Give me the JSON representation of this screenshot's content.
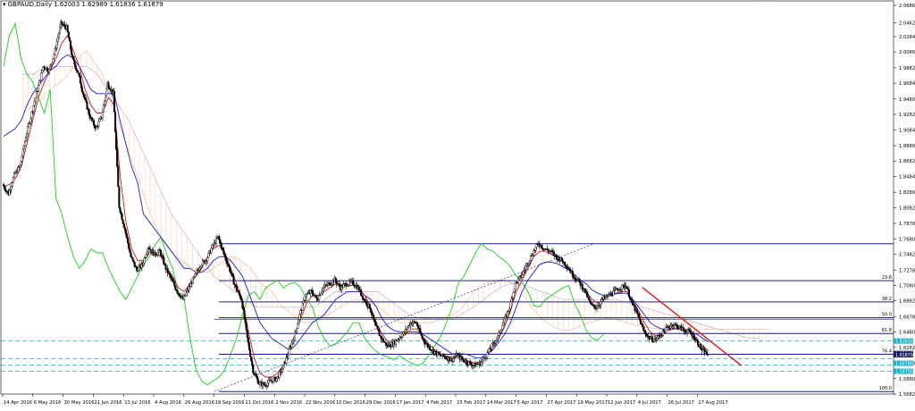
{
  "header": {
    "symbol_line": "GBPAUD,Daily",
    "ohlc": "1.62003 1.62989 1.61836 1.61879"
  },
  "colors": {
    "background": "#ffffff",
    "candle": "#000000",
    "tenkan": "#d01818",
    "kijun": "#1a1ad8",
    "chikou": "#18d018",
    "cloud": "#f2b48a",
    "fib": "#1c1c8a",
    "channel": "#2a2ab8",
    "support": "#1ab0c8",
    "trendline": "#e01818",
    "price_tag": "#1a1a60"
  },
  "chart_data": {
    "type": "line",
    "instrument": "GBPAUD",
    "timeframe": "Daily",
    "ohlc_current": {
      "open": 1.62003,
      "high": 1.62989,
      "low": 1.61836,
      "close": 1.61879
    },
    "y_ticks": [
      2.0686,
      2.0462,
      2.0284,
      2.0086,
      1.9882,
      1.9684,
      1.948,
      1.9282,
      1.9084,
      1.888,
      1.8682,
      1.8484,
      1.828,
      1.8082,
      1.7878,
      1.768,
      1.7482,
      1.7278,
      1.708,
      1.6882,
      1.6678,
      1.648,
      1.6282,
      1.6078,
      1.588,
      1.5682
    ],
    "ylim": [
      1.5682,
      2.0686
    ],
    "x_ticks": [
      "14 Apr 2016",
      "6 May 2016",
      "30 May 2016",
      "21 Jun 2016",
      "13 Jul 2016",
      "4 Aug 2016",
      "26 Aug 2016",
      "19 Sep 2016",
      "11 Oct 2016",
      "2 Nov 2016",
      "22 Nov 2016",
      "10 Dec 2016",
      "29 Dec 2016",
      "17 Jan 2017",
      "4 Feb 2017",
      "23 Feb 2017",
      "14 Mar 2017",
      "5 Apr 2017",
      "27 Apr 2017",
      "19 May 2017",
      "12 Jun 2017",
      "4 Jul 2017",
      "26 Jul 2017",
      "17 Aug 2017"
    ],
    "close_series": [
      1.838,
      1.826,
      1.85,
      1.862,
      1.9,
      1.93,
      1.96,
      1.99,
      1.985,
      2.01,
      2.045,
      2.04,
      2.0,
      1.98,
      1.95,
      1.925,
      1.91,
      1.925,
      1.968,
      1.955,
      1.81,
      1.78,
      1.745,
      1.728,
      1.735,
      1.758,
      1.748,
      1.752,
      1.73,
      1.715,
      1.7,
      1.69,
      1.705,
      1.72,
      1.735,
      1.742,
      1.758,
      1.77,
      1.748,
      1.728,
      1.705,
      1.69,
      1.64,
      1.598,
      1.582,
      1.58,
      1.585,
      1.588,
      1.6,
      1.62,
      1.64,
      1.67,
      1.695,
      1.7,
      1.69,
      1.705,
      1.71,
      1.715,
      1.705,
      1.71,
      1.712,
      1.705,
      1.69,
      1.68,
      1.655,
      1.64,
      1.63,
      1.633,
      1.64,
      1.648,
      1.66,
      1.66,
      1.64,
      1.63,
      1.623,
      1.618,
      1.616,
      1.612,
      1.618,
      1.612,
      1.608,
      1.605,
      1.608,
      1.618,
      1.63,
      1.642,
      1.66,
      1.68,
      1.71,
      1.72,
      1.735,
      1.75,
      1.762,
      1.755,
      1.752,
      1.745,
      1.74,
      1.732,
      1.72,
      1.712,
      1.7,
      1.682,
      1.68,
      1.69,
      1.695,
      1.7,
      1.705,
      1.708,
      1.685,
      1.67,
      1.65,
      1.64,
      1.638,
      1.645,
      1.653,
      1.658,
      1.655,
      1.65,
      1.648,
      1.638,
      1.625,
      1.619
    ],
    "series": [
      {
        "name": "Tenkan",
        "values": [
          1.835,
          1.838,
          1.845,
          1.86,
          1.89,
          1.92,
          1.95,
          1.97,
          1.985,
          2.0,
          2.02,
          2.03,
          2.01,
          1.99,
          1.96,
          1.94,
          1.93,
          1.93,
          1.95,
          1.94,
          1.85,
          1.79,
          1.755,
          1.74,
          1.74,
          1.75,
          1.75,
          1.745,
          1.73,
          1.72,
          1.705,
          1.7,
          1.71,
          1.72,
          1.73,
          1.745,
          1.755,
          1.76,
          1.75,
          1.73,
          1.71,
          1.69,
          1.65,
          1.615,
          1.595,
          1.59,
          1.59,
          1.595,
          1.605,
          1.625,
          1.645,
          1.665,
          1.685,
          1.695,
          1.695,
          1.7,
          1.705,
          1.71,
          1.708,
          1.708,
          1.708,
          1.704,
          1.695,
          1.68,
          1.66,
          1.645,
          1.635,
          1.635,
          1.64,
          1.645,
          1.652,
          1.652,
          1.642,
          1.632,
          1.625,
          1.62,
          1.617,
          1.615,
          1.617,
          1.614,
          1.61,
          1.608,
          1.61,
          1.618,
          1.628,
          1.64,
          1.655,
          1.675,
          1.7,
          1.715,
          1.73,
          1.745,
          1.752,
          1.752,
          1.748,
          1.744,
          1.738,
          1.73,
          1.72,
          1.71,
          1.7,
          1.69,
          1.685,
          1.69,
          1.695,
          1.698,
          1.7,
          1.7,
          1.688,
          1.675,
          1.66,
          1.648,
          1.643,
          1.645,
          1.65,
          1.653,
          1.652,
          1.649,
          1.645,
          1.638,
          1.63,
          1.624
        ]
      },
      {
        "name": "Kijun",
        "values": [
          1.9,
          1.905,
          1.91,
          1.92,
          1.94,
          1.955,
          1.965,
          1.975,
          1.985,
          1.99,
          2.0,
          2.005,
          2.0,
          1.99,
          1.975,
          1.96,
          1.955,
          1.955,
          1.955,
          1.955,
          1.92,
          1.89,
          1.86,
          1.84,
          1.8,
          1.79,
          1.78,
          1.77,
          1.76,
          1.75,
          1.74,
          1.73,
          1.73,
          1.725,
          1.725,
          1.73,
          1.74,
          1.745,
          1.745,
          1.74,
          1.73,
          1.72,
          1.7,
          1.68,
          1.66,
          1.65,
          1.64,
          1.635,
          1.63,
          1.625,
          1.63,
          1.64,
          1.65,
          1.66,
          1.665,
          1.67,
          1.68,
          1.69,
          1.695,
          1.7,
          1.7,
          1.7,
          1.695,
          1.69,
          1.68,
          1.665,
          1.655,
          1.65,
          1.648,
          1.648,
          1.648,
          1.648,
          1.645,
          1.64,
          1.635,
          1.63,
          1.625,
          1.62,
          1.62,
          1.62,
          1.618,
          1.615,
          1.615,
          1.62,
          1.625,
          1.635,
          1.645,
          1.66,
          1.68,
          1.7,
          1.715,
          1.725,
          1.735,
          1.738,
          1.738,
          1.736,
          1.732,
          1.728,
          1.722,
          1.715,
          1.71,
          1.702,
          1.698,
          1.695,
          1.695,
          1.697,
          1.698,
          1.698,
          1.69,
          1.68,
          1.67,
          1.66,
          1.655,
          1.652,
          1.652,
          1.652,
          1.652,
          1.65,
          1.648,
          1.645,
          1.64,
          1.635
        ]
      },
      {
        "name": "Chikou",
        "values": [
          1.99,
          2.03,
          2.045,
          2.0,
          1.98,
          1.97,
          1.95,
          1.93,
          1.96,
          1.82,
          1.8,
          1.77,
          1.745,
          1.73,
          1.74,
          1.755,
          1.75,
          1.75,
          1.73,
          1.715,
          1.7,
          1.69,
          1.705,
          1.72,
          1.735,
          1.745,
          1.76,
          1.77,
          1.748,
          1.73,
          1.7,
          1.69,
          1.64,
          1.6,
          1.585,
          1.58,
          1.585,
          1.59,
          1.6,
          1.62,
          1.64,
          1.67,
          1.695,
          1.7,
          1.69,
          1.705,
          1.71,
          1.715,
          1.705,
          1.71,
          1.712,
          1.705,
          1.69,
          1.68,
          1.655,
          1.64,
          1.63,
          1.633,
          1.64,
          1.648,
          1.66,
          1.66,
          1.64,
          1.63,
          1.623,
          1.618,
          1.616,
          1.612,
          1.618,
          1.612,
          1.608,
          1.605,
          1.608,
          1.618,
          1.63,
          1.642,
          1.66,
          1.68,
          1.71,
          1.72,
          1.735,
          1.75,
          1.762,
          1.755,
          1.752,
          1.745,
          1.74,
          1.732,
          1.72,
          1.712,
          1.7,
          1.682,
          1.68,
          1.69,
          1.695,
          1.7,
          1.705,
          1.708,
          1.685,
          1.67,
          1.65,
          1.64,
          1.638,
          1.645
        ]
      },
      {
        "name": "Senkou A",
        "values": [
          1.93,
          1.935,
          1.94,
          1.945,
          1.95,
          1.96,
          1.965,
          1.97,
          1.975,
          1.985,
          1.995,
          2.005,
          2.01,
          2.0,
          1.99,
          1.98,
          1.96,
          1.94,
          1.92,
          1.9,
          1.88,
          1.86,
          1.84,
          1.82,
          1.8,
          1.785,
          1.77,
          1.76,
          1.75,
          1.745,
          1.738,
          1.735,
          1.73,
          1.728,
          1.725,
          1.725,
          1.73,
          1.735,
          1.74,
          1.745,
          1.745,
          1.74,
          1.735,
          1.73,
          1.72,
          1.71,
          1.705,
          1.7,
          1.69,
          1.68,
          1.675,
          1.67,
          1.665,
          1.66,
          1.66,
          1.662,
          1.665,
          1.668,
          1.672,
          1.676,
          1.68,
          1.685,
          1.688,
          1.69,
          1.69,
          1.688,
          1.685,
          1.68,
          1.675,
          1.67,
          1.665,
          1.66,
          1.66,
          1.66,
          1.66,
          1.66,
          1.66,
          1.66,
          1.662,
          1.665,
          1.668,
          1.67,
          1.675,
          1.68,
          1.69,
          1.7,
          1.705,
          1.71,
          1.712,
          1.714,
          1.715,
          1.715,
          1.712,
          1.708,
          1.7,
          1.69,
          1.68,
          1.672,
          1.665,
          1.66,
          1.655,
          1.652,
          1.65,
          1.65,
          1.652,
          1.655,
          1.658,
          1.66,
          1.662,
          1.664,
          1.665,
          1.665,
          1.664,
          1.662,
          1.66,
          1.658,
          1.656,
          1.655,
          1.654,
          1.653,
          1.652,
          1.652,
          1.652,
          1.652,
          1.652,
          1.652,
          1.652,
          1.652,
          1.652,
          1.652,
          1.652,
          1.652,
          1.652,
          1.652,
          1.652,
          1.652,
          1.652,
          1.652,
          1.652,
          1.652,
          1.652,
          1.652
        ]
      },
      {
        "name": "Senkou B",
        "values": [
          1.98,
          1.98,
          1.98,
          1.985,
          1.985,
          1.99,
          1.99,
          1.99,
          1.99,
          1.99,
          1.99,
          1.99,
          1.99,
          1.985,
          1.98,
          1.97,
          1.96,
          1.95,
          1.94,
          1.93,
          1.92,
          1.905,
          1.89,
          1.875,
          1.86,
          1.845,
          1.83,
          1.815,
          1.8,
          1.79,
          1.78,
          1.77,
          1.76,
          1.75,
          1.74,
          1.73,
          1.72,
          1.715,
          1.71,
          1.705,
          1.7,
          1.695,
          1.69,
          1.685,
          1.68,
          1.68,
          1.68,
          1.68,
          1.68,
          1.68,
          1.68,
          1.68,
          1.68,
          1.68,
          1.68,
          1.68,
          1.685,
          1.69,
          1.695,
          1.7,
          1.7,
          1.7,
          1.7,
          1.7,
          1.7,
          1.7,
          1.7,
          1.7,
          1.695,
          1.69,
          1.685,
          1.68,
          1.675,
          1.67,
          1.668,
          1.666,
          1.665,
          1.665,
          1.665,
          1.665,
          1.665,
          1.665,
          1.668,
          1.672,
          1.676,
          1.68,
          1.685,
          1.69,
          1.695,
          1.7,
          1.705,
          1.708,
          1.71,
          1.71,
          1.71,
          1.708,
          1.705,
          1.702,
          1.7,
          1.698,
          1.695,
          1.692,
          1.69,
          1.69,
          1.69,
          1.69,
          1.69,
          1.69,
          1.69,
          1.69,
          1.69,
          1.69,
          1.69,
          1.688,
          1.686,
          1.684,
          1.682,
          1.68,
          1.678,
          1.676,
          1.674,
          1.672,
          1.67,
          1.668,
          1.666,
          1.664,
          1.662,
          1.66,
          1.658,
          1.656,
          1.654,
          1.652,
          1.65,
          1.648,
          1.646,
          1.644,
          1.642,
          1.64,
          1.64,
          1.64
        ]
      }
    ],
    "annotations": {
      "fib_levels": [
        {
          "label": "",
          "value": 1.7618
        },
        {
          "label": "23.6",
          "value": 1.7142
        },
        {
          "label": "38.2",
          "value": 1.6868
        },
        {
          "label": "50.0",
          "value": 1.6664
        },
        {
          "label": "61.8",
          "value": 1.6462
        },
        {
          "label": "76.4",
          "value": 1.6194
        },
        {
          "label": "100.0",
          "value": 1.5714
        }
      ],
      "support_levels": [
        1.6365,
        1.6135,
        1.6052,
        1.5975
      ],
      "price_tags": [
        "1.63650",
        "1.62040",
        "1.61879",
        "1.60780",
        "1.59750"
      ],
      "trendline_down": {
        "from": [
          "4 Jul 2017",
          1.7055
        ],
        "to": [
          "24 Aug 2017",
          1.6045
        ]
      },
      "trendline_dotted": {
        "from": [
          "19 Sep 2016",
          1.5714
        ],
        "to": [
          "19 May 2017",
          1.7618
        ]
      },
      "channel_lines": [
        {
          "from": [
            "19 Sep 2016",
            1.6645
          ],
          "to": [
            "11 Jun 2017",
            1.6645
          ]
        }
      ]
    }
  }
}
